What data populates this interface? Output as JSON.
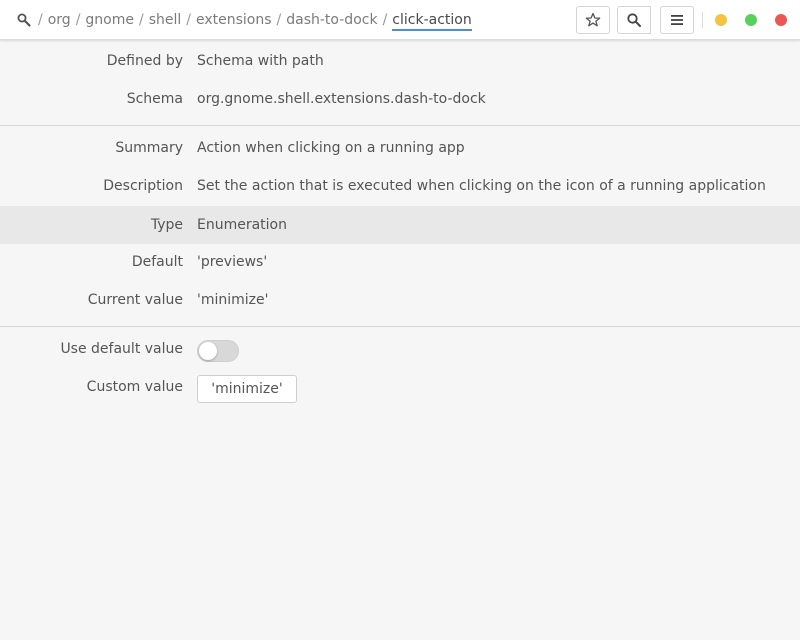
{
  "header": {
    "path": [
      {
        "label": "org"
      },
      {
        "label": "gnome"
      },
      {
        "label": "shell"
      },
      {
        "label": "extensions"
      },
      {
        "label": "dash-to-dock"
      }
    ],
    "current_key": "click-action",
    "separator": "/",
    "root_icon": "key-search-icon",
    "buttons": {
      "bookmark_icon": "star-icon",
      "search_icon": "search-icon",
      "menu_icon": "hamburger-menu-icon"
    },
    "window_controls": {
      "minimize_color": "#f4c342",
      "maximize_color": "#5ad05c",
      "close_color": "#ee5555"
    }
  },
  "info": {
    "defined_by": {
      "label": "Defined by",
      "value": "Schema with path"
    },
    "schema": {
      "label": "Schema",
      "value": "org.gnome.shell.extensions.dash-to-dock"
    },
    "summary": {
      "label": "Summary",
      "value": "Action when clicking on a running app"
    },
    "description": {
      "label": "Description",
      "value": "Set the action that is executed when clicking on the icon of a running application"
    },
    "type": {
      "label": "Type",
      "value": "Enumeration"
    },
    "default": {
      "label": "Default",
      "value": "'previews'"
    },
    "current_value": {
      "label": "Current value",
      "value": "'minimize'"
    }
  },
  "settings": {
    "use_default": {
      "label": "Use default value",
      "checked": false
    },
    "custom_value": {
      "label": "Custom value",
      "value": "'minimize'"
    }
  },
  "colors": {
    "accent": "#4a90d9",
    "highlight_row": "#e8e8e8"
  }
}
